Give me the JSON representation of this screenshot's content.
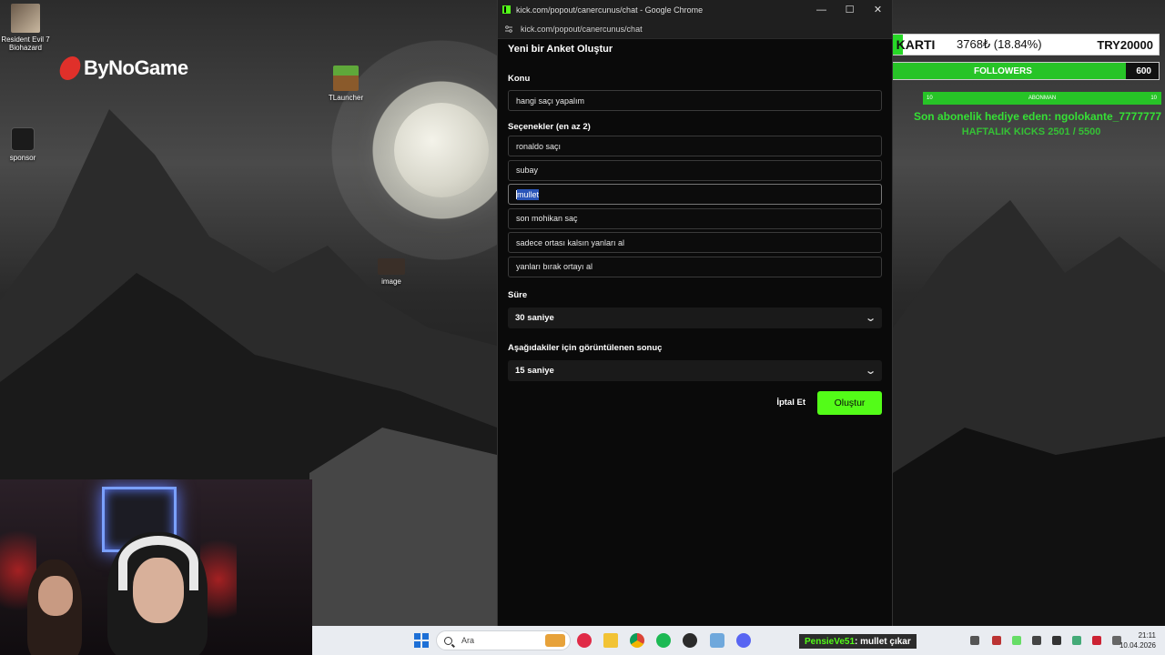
{
  "desktop": {
    "icons": [
      {
        "label": "Resident Evil 7 Biohazard"
      },
      {
        "label": "sponsor"
      },
      {
        "label": "TLauncher"
      },
      {
        "label": "image"
      }
    ],
    "brand_logo": "ByNoGame"
  },
  "overlay": {
    "gpu": {
      "label": "EKRAN KARTI",
      "value": "3768₺ (18.84%)",
      "target": "TRY20000",
      "progress": 0.1884
    },
    "followers": {
      "current": "537",
      "label": "FOLLOWERS",
      "goal": "600",
      "progress": 0.895
    },
    "subs": {
      "current": "10",
      "label": "ABONMAN",
      "goal": "10",
      "progress": 1.0
    },
    "gift_text": "Son abonelik hediye eden: ngolokante_7777777",
    "kicks_text": "HAFTALIK KICKS 2501 / 5500"
  },
  "chrome": {
    "title": "kick.com/popout/canercunus/chat - Google Chrome",
    "url": "kick.com/popout/canercunus/chat",
    "controls": {
      "minimize": "—",
      "maximize": "☐",
      "close": "✕"
    }
  },
  "poll": {
    "title": "Yeni bir Anket Oluştur",
    "topic_label": "Konu",
    "topic_value": "hangi saçı yapalım",
    "options_label": "Seçenekler (en az 2)",
    "options": [
      "ronaldo saçı",
      "subay",
      "mullet",
      "son mohikan saç",
      "sadece ortası kalsın yanları al",
      "yanları bırak ortayı al"
    ],
    "duration_label": "Süre",
    "duration_value": "30 saniye",
    "result_label": "Aşağıdakiler için görüntülenen sonuç",
    "result_value": "15 saniye",
    "cancel_label": "İptal Et",
    "create_label": "Oluştur"
  },
  "taskbar": {
    "search_placeholder": "Ara",
    "chat_user": "PensieVe51",
    "chat_message": " : mullet çıkar",
    "time": "21:11",
    "date": "10.04.2026"
  },
  "colors": {
    "kick_green": "#53fc18",
    "overlay_green": "#27d827"
  }
}
